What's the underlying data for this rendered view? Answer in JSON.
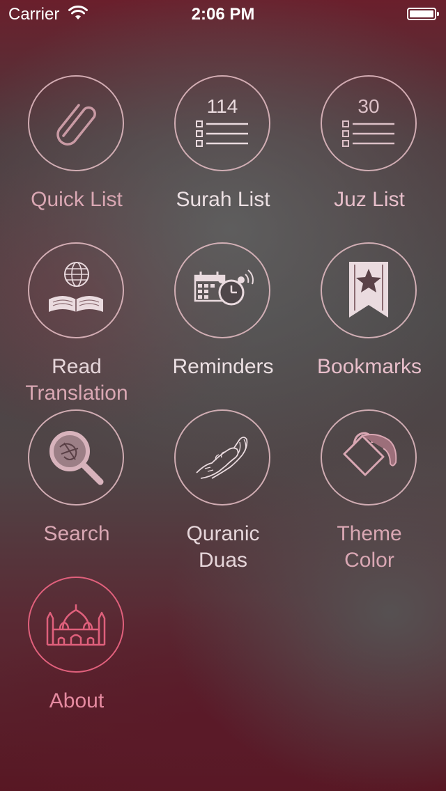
{
  "status_bar": {
    "carrier": "Carrier",
    "time": "2:06 PM"
  },
  "menu": {
    "quick_list": {
      "label": "Quick List",
      "icon": "paperclip-icon"
    },
    "surah_list": {
      "label": "Surah List",
      "count": "114",
      "icon": "list-icon"
    },
    "juz_list": {
      "label": "Juz List",
      "count": "30",
      "icon": "list-icon"
    },
    "read_translation": {
      "label_line1": "Read",
      "label_line2": "Translation",
      "icon": "book-globe-icon"
    },
    "reminders": {
      "label": "Reminders",
      "icon": "calendar-alarm-icon"
    },
    "bookmarks": {
      "label": "Bookmarks",
      "icon": "bookmark-star-icon"
    },
    "search": {
      "label": "Search",
      "icon": "search-quran-icon"
    },
    "quranic_duas": {
      "label_line1": "Quranic",
      "label_line2": "Duas",
      "icon": "praying-hands-icon"
    },
    "theme_color": {
      "label_line1": "Theme",
      "label_line2": "Color",
      "icon": "paint-bucket-icon"
    },
    "about": {
      "label": "About",
      "icon": "mosque-icon"
    }
  },
  "colors": {
    "circle_border": "#e6bec6",
    "label_pink": "#d9a7b3",
    "about_accent": "#e0607c"
  }
}
